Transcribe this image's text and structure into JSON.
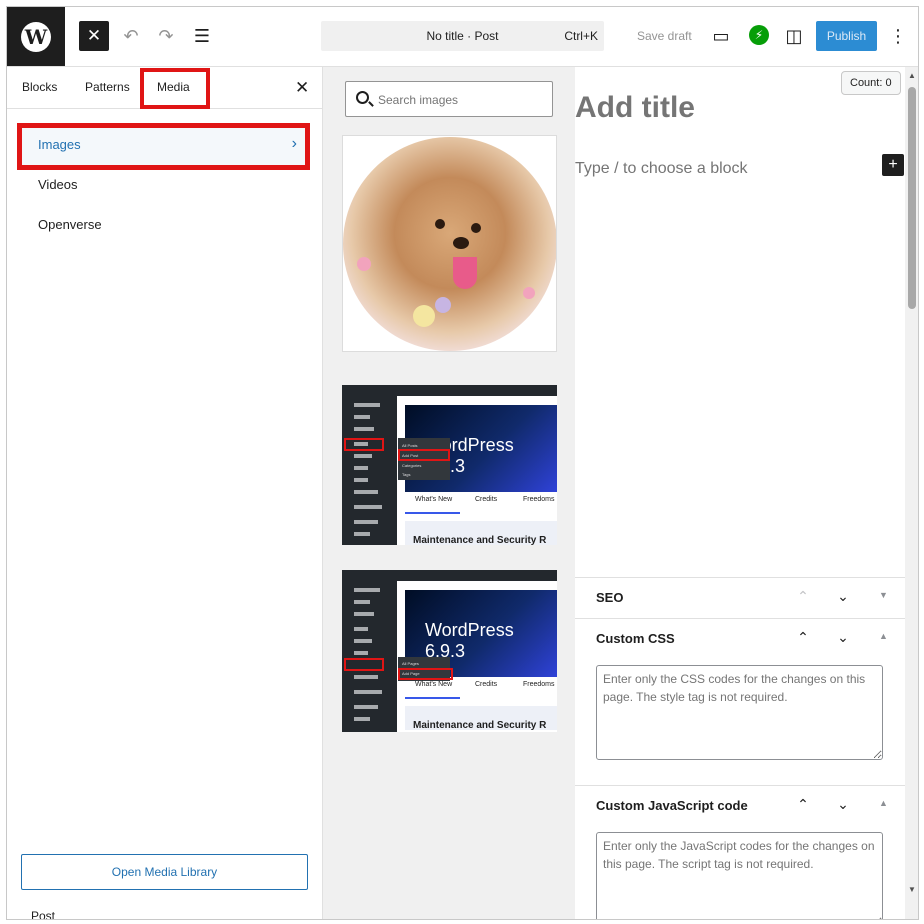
{
  "topbar": {
    "logo_glyph": "W",
    "close_glyph": "✕",
    "undo_glyph": "↶",
    "redo_glyph": "↷",
    "list_view_glyph": "☰",
    "document_title": "No title · Post",
    "shortcut": "Ctrl+K",
    "save_draft": "Save draft",
    "preview_glyph": "▭",
    "jetpack_glyph": "⚡",
    "settings_glyph": "◫",
    "publish": "Publish",
    "options_glyph": "⋮"
  },
  "inserter": {
    "tabs": [
      "Blocks",
      "Patterns",
      "Media"
    ],
    "active_tab": "Media",
    "close_glyph": "✕",
    "categories": [
      "Images",
      "Videos",
      "Openverse"
    ],
    "active_category": "Images",
    "chevron_glyph": "›",
    "open_library": "Open Media Library",
    "footer_label": "Post"
  },
  "media": {
    "search_placeholder": "Search images",
    "shot1": {
      "hero_lines": [
        "WordPress",
        "6.9.3"
      ],
      "tabs": [
        "What's New",
        "Credits",
        "Freedoms"
      ],
      "heading": "Maintenance and Security R",
      "flyout": [
        "All Posts",
        "Add Post",
        "Categories",
        "Tags"
      ]
    },
    "shot2": {
      "hero_lines": [
        "WordPress",
        "6.9.3"
      ],
      "tabs": [
        "What's New",
        "Credits",
        "Freedoms"
      ],
      "heading": "Maintenance and Security R",
      "flyout": [
        "All Pages",
        "Add Page"
      ]
    }
  },
  "editor": {
    "count": "Count: 0",
    "title_placeholder": "Add title",
    "block_placeholder": "Type / to choose a block",
    "plus_glyph": "+"
  },
  "metaboxes": {
    "up_glyph": "⌃",
    "down_glyph": "⌄",
    "collapse_glyph": "▲",
    "expand_glyph": "▼",
    "seo_title": "SEO",
    "css_title": "Custom CSS",
    "css_placeholder": "Enter only the CSS codes for the changes on this page. The style tag is not required.",
    "js_title": "Custom JavaScript code",
    "js_placeholder": "Enter only the JavaScript codes for the changes on this page. The script tag is not required."
  },
  "scrollbar": {
    "up_glyph": "▲",
    "down_glyph": "▼"
  },
  "colors": {
    "accent": "#2271b1",
    "publish": "#2c8cd3",
    "highlight": "#e01515",
    "jetpack": "#069e08"
  }
}
